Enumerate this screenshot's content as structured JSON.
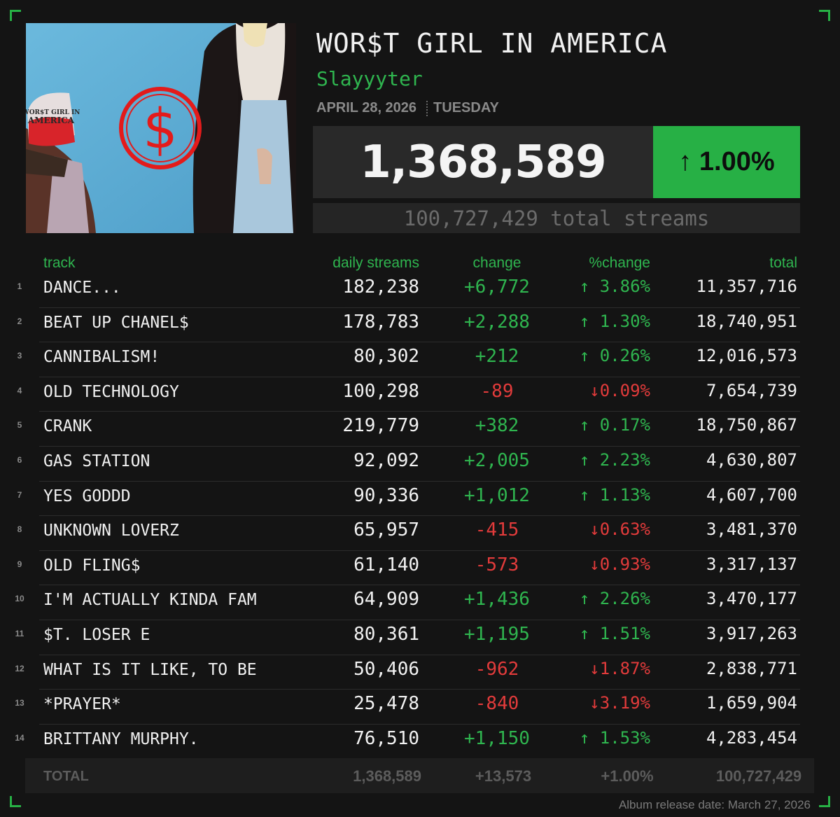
{
  "album": {
    "title": "WOR$T GIRL IN AMERICA",
    "artist": "Slayyyter",
    "date": "APRIL 28, 2026",
    "weekday": "TUESDAY",
    "cover_hat_text": "WOR$T GIRL IN AMERICA",
    "cover_symbol": "$"
  },
  "summary": {
    "daily_streams": "1,368,589",
    "percent_change": "↑ 1.00%",
    "total_streams_text": "100,727,429 total streams"
  },
  "columns": {
    "track": "track",
    "daily": "daily streams",
    "change": "change",
    "pct": "%change",
    "total": "total"
  },
  "tracks": [
    {
      "num": "1",
      "name": "DANCE...",
      "daily": "182,238",
      "change": "+6,772",
      "pct": "↑ 3.86%",
      "total": "11,357,716",
      "dir": "up"
    },
    {
      "num": "2",
      "name": "BEAT UP CHANEL$",
      "daily": "178,783",
      "change": "+2,288",
      "pct": "↑ 1.30%",
      "total": "18,740,951",
      "dir": "up"
    },
    {
      "num": "3",
      "name": "CANNIBALISM!",
      "daily": "80,302",
      "change": "+212",
      "pct": "↑ 0.26%",
      "total": "12,016,573",
      "dir": "up"
    },
    {
      "num": "4",
      "name": "OLD TECHNOLOGY",
      "daily": "100,298",
      "change": "-89",
      "pct": "↓0.09%",
      "total": "7,654,739",
      "dir": "down"
    },
    {
      "num": "5",
      "name": "CRANK",
      "daily": "219,779",
      "change": "+382",
      "pct": "↑ 0.17%",
      "total": "18,750,867",
      "dir": "up"
    },
    {
      "num": "6",
      "name": "GAS STATION",
      "daily": "92,092",
      "change": "+2,005",
      "pct": "↑ 2.23%",
      "total": "4,630,807",
      "dir": "up"
    },
    {
      "num": "7",
      "name": "YES GODDD",
      "daily": "90,336",
      "change": "+1,012",
      "pct": "↑ 1.13%",
      "total": "4,607,700",
      "dir": "up"
    },
    {
      "num": "8",
      "name": "UNKNOWN LOVERZ",
      "daily": "65,957",
      "change": "-415",
      "pct": "↓0.63%",
      "total": "3,481,370",
      "dir": "down"
    },
    {
      "num": "9",
      "name": "OLD FLING$",
      "daily": "61,140",
      "change": "-573",
      "pct": "↓0.93%",
      "total": "3,317,137",
      "dir": "down"
    },
    {
      "num": "10",
      "name": "I'M ACTUALLY KINDA FAM",
      "daily": "64,909",
      "change": "+1,436",
      "pct": "↑ 2.26%",
      "total": "3,470,177",
      "dir": "up"
    },
    {
      "num": "11",
      "name": "$T. LOSER E",
      "daily": "80,361",
      "change": "+1,195",
      "pct": "↑ 1.51%",
      "total": "3,917,263",
      "dir": "up"
    },
    {
      "num": "12",
      "name": "WHAT IS IT LIKE, TO BE",
      "daily": "50,406",
      "change": "-962",
      "pct": "↓1.87%",
      "total": "2,838,771",
      "dir": "down"
    },
    {
      "num": "13",
      "name": "*PRAYER*",
      "daily": "25,478",
      "change": "-840",
      "pct": "↓3.19%",
      "total": "1,659,904",
      "dir": "down"
    },
    {
      "num": "14",
      "name": "BRITTANY MURPHY.",
      "daily": "76,510",
      "change": "+1,150",
      "pct": "↑ 1.53%",
      "total": "4,283,454",
      "dir": "up"
    }
  ],
  "totals": {
    "label": "TOTAL",
    "daily": "1,368,589",
    "change": "+13,573",
    "pct": "+1.00%",
    "total": "100,727,429"
  },
  "footer": {
    "release_date": "Album release date: March 27, 2026"
  },
  "colors": {
    "accent_green": "#27b045",
    "negative_red": "#e23b3b",
    "background": "#141414"
  }
}
